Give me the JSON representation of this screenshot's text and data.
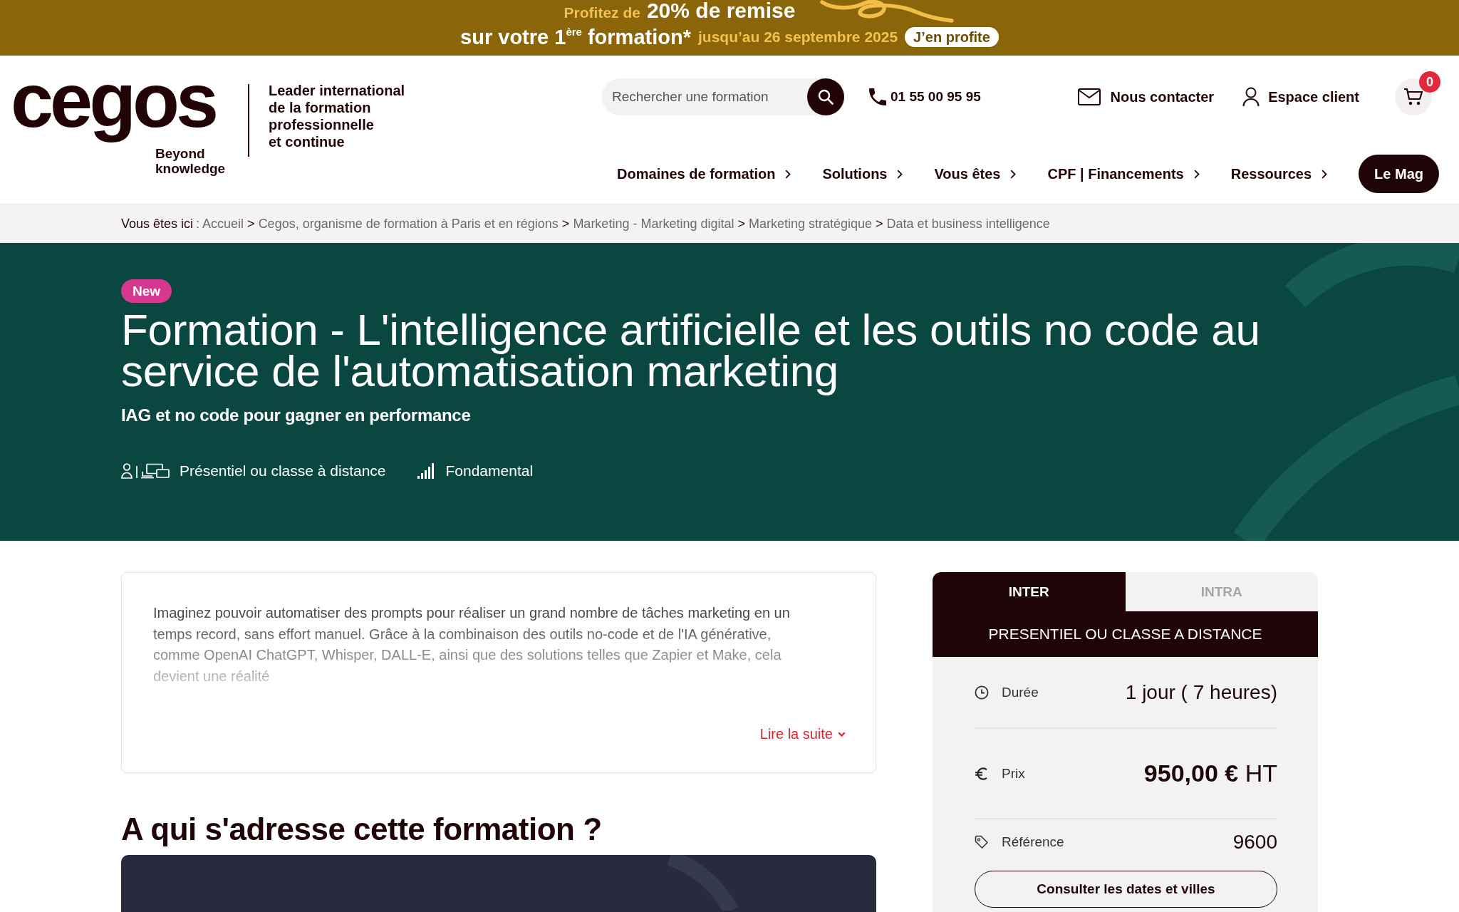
{
  "promo_banner": {
    "intro": "Profitez de",
    "offer": "20% de remise",
    "headline": "sur votre 1$^{ère}$ formation*",
    "deadline": "jusqu’au 26 septembre 2025",
    "button": "J’en profite"
  },
  "header": {
    "logo": {
      "wordmark": "cegos",
      "slogan": "Beyond knowledge"
    },
    "baseline": "Leader international\nde la formation\nprofessionnelle\net continue",
    "search": {
      "placeholder": "Rechercher une formation"
    },
    "phone": "01 55 00 95 95",
    "contact": "Nous contacter",
    "account": "Espace client",
    "cart_count": "0"
  },
  "nav": [
    {
      "label": "Domaines de formation",
      "kind": "menu"
    },
    {
      "label": "Solutions",
      "kind": "menu"
    },
    {
      "label": "Vous êtes",
      "kind": "menu"
    },
    {
      "label": "CPF | Financements",
      "kind": "menu"
    },
    {
      "label": "Ressources",
      "kind": "menu"
    },
    {
      "label": "Le Mag",
      "kind": "button"
    }
  ],
  "breadcrumb": {
    "prefix": "Vous êtes ici",
    "prefix_separator": ":",
    "items": [
      {
        "label": "Accueil"
      },
      {
        "separator": ">",
        "label": "Cegos, organisme de formation à Paris et en régions"
      },
      {
        "separator": ">",
        "label": "Marketing - Marketing digital"
      },
      {
        "separator": ">",
        "label": "Marketing stratégique"
      },
      {
        "separator": ">",
        "label": "Data et business intelligence"
      }
    ]
  },
  "hero": {
    "badge": "New",
    "title": "Formation - L'intelligence artificielle et les outils no code au service de l'automatisation marketing",
    "subtitle": "IAG et no code pour gagner en performance",
    "meta": [
      {
        "kind": "format",
        "text": "Présentiel ou classe à distance"
      },
      {
        "kind": "level",
        "text": "Fondamental"
      }
    ]
  },
  "description": {
    "text": "Imaginez pouvoir automatiser des prompts pour réaliser un grand nombre de tâches marketing en un temps record, sans effort manuel. Grâce à la combinaison des outils no-code et de l'IA générative, comme OpenAI ChatGPT, Whisper, DALL-E, ainsi que des solutions telles que Zapier et Make, cela devient une réalité",
    "more_link": "Lire la suite"
  },
  "audience": {
    "heading": "A qui s'adresse cette formation ?"
  },
  "offer_panel": {
    "tabs": [
      {
        "label": "INTER",
        "selected": true
      },
      {
        "label": "INTRA",
        "selected": false
      }
    ],
    "format": "PRESENTIEL OU CLASSE A DISTANCE",
    "rows": [
      {
        "kind": "duration",
        "label": "Durée",
        "value": "1 jour ( 7 heures)"
      },
      {
        "kind": "price",
        "label": "Prix",
        "value": "**950,00 €** HT"
      },
      {
        "kind": "reference",
        "label": "Référence",
        "value": "9600"
      }
    ],
    "button": "Consulter les dates et villes"
  }
}
